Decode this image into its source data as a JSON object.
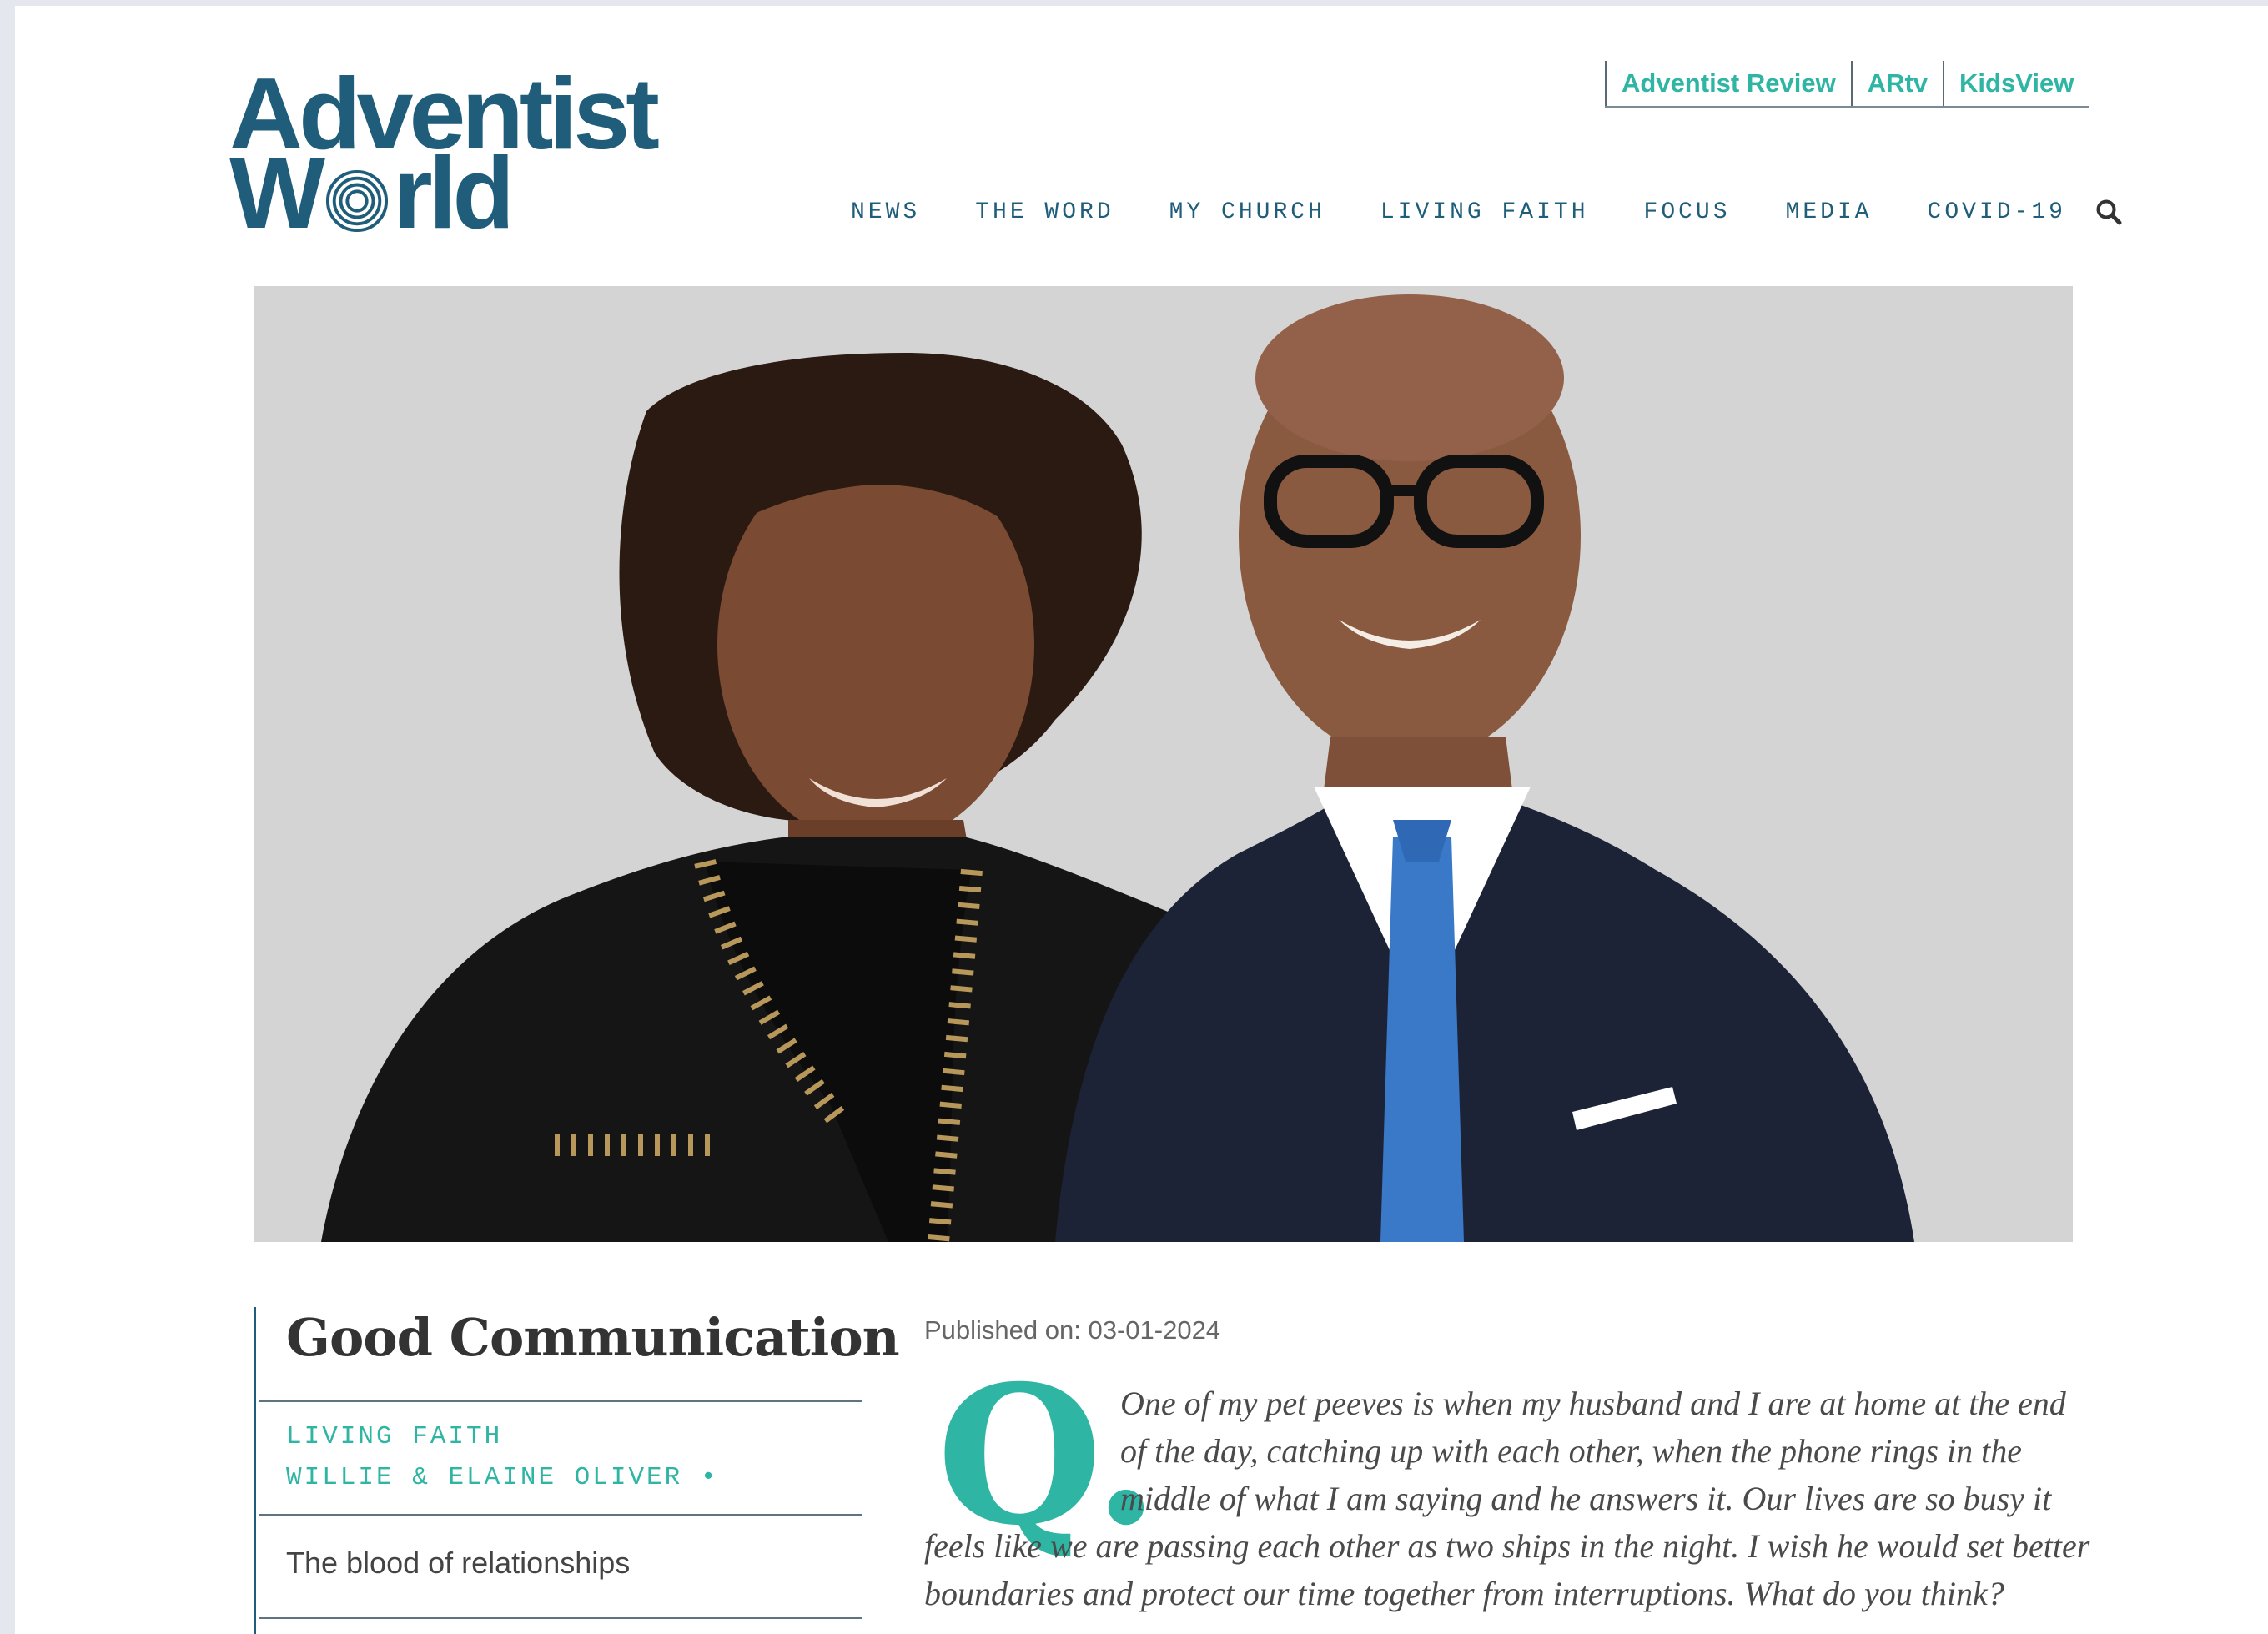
{
  "brand": {
    "logo_line1": "Adventist",
    "logo_line2_prefix": "W",
    "logo_line2_suffix": "rld",
    "primary_color": "#1f5d7a",
    "accent_color": "#2fb5a4"
  },
  "top_links": [
    "Adventist Review",
    "ARtv",
    "KidsView"
  ],
  "nav": {
    "items": [
      "NEWS",
      "THE WORD",
      "MY CHURCH",
      "LIVING FAITH",
      "FOCUS",
      "MEDIA",
      "COVID-19"
    ],
    "search_icon": "search-icon"
  },
  "article": {
    "title": "Good Communication",
    "category": "LIVING FAITH",
    "authors": "WILLIE & ELAINE OLIVER •",
    "subtitle": "The blood of relationships",
    "published": "Published on: 03-01-2024",
    "drop_cap": "Q.",
    "question_lines": [
      "One of my pet peeves is when my husband and I are at home at the end",
      "of the day, catching up with each other, when the phone rings in the",
      "middle of what I am saying and he answers it. Our lives are so busy it",
      "feels like we are passing each other as two ships in the night. I wish he would set better",
      "boundaries and protect our time together from interruptions. What do you think?"
    ]
  }
}
